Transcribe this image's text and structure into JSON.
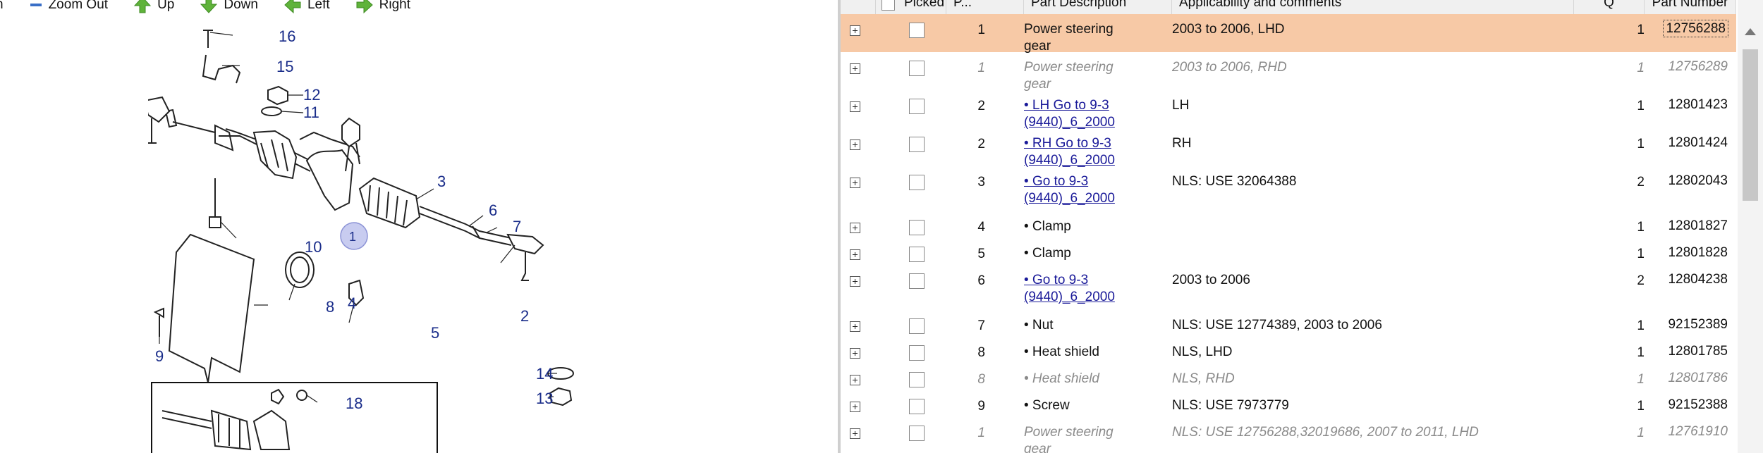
{
  "toolbar": {
    "items": [
      {
        "label": "h",
        "icon": "zoom-in-icon"
      },
      {
        "label": "Zoom Out",
        "icon": "zoom-out-icon"
      },
      {
        "label": "Up",
        "icon": "arrow-up-icon"
      },
      {
        "label": "Down",
        "icon": "arrow-down-icon"
      },
      {
        "label": "Left",
        "icon": "arrow-left-icon"
      },
      {
        "label": "Right",
        "icon": "arrow-right-icon"
      }
    ]
  },
  "diagram": {
    "callouts": [
      "16",
      "15",
      "12",
      "11",
      "3",
      "6",
      "7",
      "1",
      "10",
      "8",
      "4",
      "5",
      "2",
      "9",
      "14",
      "13",
      "18"
    ]
  },
  "table": {
    "headers": {
      "picked": "Picked",
      "pos": "P...",
      "description": "Part Description",
      "applicability": "Applicability and comments",
      "qty": "Q",
      "part_number": "Part Number"
    },
    "rows": [
      {
        "pos": "1",
        "desc": "Power steering gear",
        "link": false,
        "app": "2003 to 2006, LHD",
        "qty": "1",
        "pn": "12756288",
        "selected": true,
        "grey": false
      },
      {
        "pos": "1",
        "desc": "Power steering gear",
        "link": false,
        "app": "2003 to 2006, RHD",
        "qty": "1",
        "pn": "12756289",
        "selected": false,
        "grey": true
      },
      {
        "pos": "2",
        "desc": "• LH Go to 9-3 (9440)_6_2000",
        "link": true,
        "app": "LH",
        "qty": "1",
        "pn": "12801423",
        "selected": false,
        "grey": false
      },
      {
        "pos": "2",
        "desc": "• RH Go to 9-3 (9440)_6_2000",
        "link": true,
        "app": "RH",
        "qty": "1",
        "pn": "12801424",
        "selected": false,
        "grey": false
      },
      {
        "pos": "3",
        "desc": "• Go to 9-3 (9440)_6_2000",
        "link": true,
        "app": "NLS: USE 32064388",
        "qty": "2",
        "pn": "12802043",
        "selected": false,
        "grey": false
      },
      {
        "pos": "4",
        "desc": "• Clamp",
        "link": false,
        "app": "",
        "qty": "1",
        "pn": "12801827",
        "selected": false,
        "grey": false
      },
      {
        "pos": "5",
        "desc": "• Clamp",
        "link": false,
        "app": "",
        "qty": "1",
        "pn": "12801828",
        "selected": false,
        "grey": false
      },
      {
        "pos": "6",
        "desc": "• Go to 9-3 (9440)_6_2000",
        "link": true,
        "app": "2003 to 2006",
        "qty": "2",
        "pn": "12804238",
        "selected": false,
        "grey": false
      },
      {
        "pos": "7",
        "desc": "• Nut",
        "link": false,
        "app": "NLS: USE 12774389, 2003 to 2006",
        "qty": "1",
        "pn": "92152389",
        "selected": false,
        "grey": false
      },
      {
        "pos": "8",
        "desc": "• Heat shield",
        "link": false,
        "app": "NLS, LHD",
        "qty": "1",
        "pn": "12801785",
        "selected": false,
        "grey": false
      },
      {
        "pos": "8",
        "desc": "• Heat shield",
        "link": false,
        "app": "NLS, RHD",
        "qty": "1",
        "pn": "12801786",
        "selected": false,
        "grey": true
      },
      {
        "pos": "9",
        "desc": "• Screw",
        "link": false,
        "app": "NLS: USE 7973779",
        "qty": "1",
        "pn": "92152388",
        "selected": false,
        "grey": false
      },
      {
        "pos": "1",
        "desc": "Power steering gear",
        "link": false,
        "app": "NLS: USE 12756288,32019686, 2007 to 2011, LHD",
        "qty": "1",
        "pn": "12761910",
        "selected": false,
        "grey": true
      }
    ]
  },
  "colors": {
    "selected_row": "#f7c9a6",
    "link": "#1a1a99",
    "callout": "#1a2d8a",
    "toolbar_arrow": "#5fb33a",
    "toolbar_zoom": "#3a6fc7"
  }
}
